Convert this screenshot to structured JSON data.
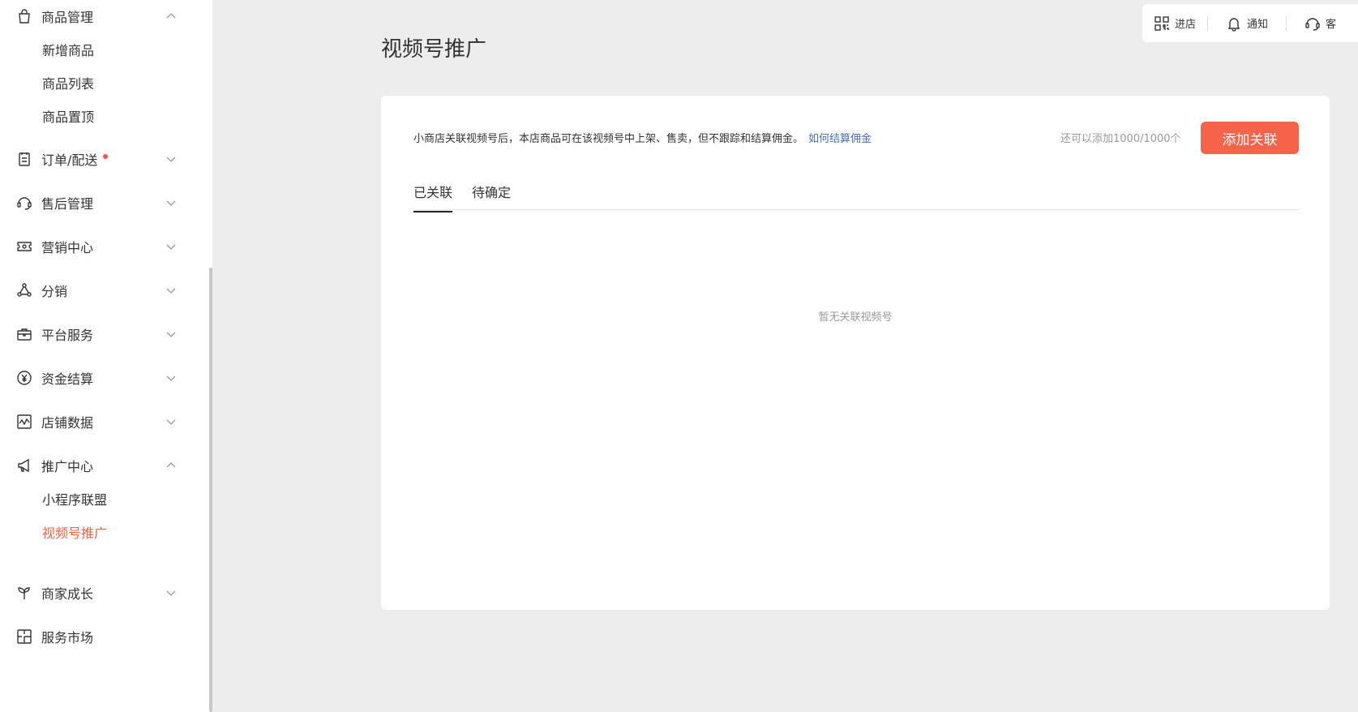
{
  "sidebar": {
    "groups": [
      {
        "label": "商品管理",
        "icon": "bag-icon",
        "expanded": true,
        "items": [
          "新增商品",
          "商品列表",
          "商品置顶"
        ]
      },
      {
        "label": "订单/配送",
        "icon": "clipboard-icon",
        "expanded": false,
        "badge_dot": true
      },
      {
        "label": "售后管理",
        "icon": "headset-icon",
        "expanded": false
      },
      {
        "label": "营销中心",
        "icon": "ticket-icon",
        "expanded": false
      },
      {
        "label": "分销",
        "icon": "share-nodes-icon",
        "expanded": false
      },
      {
        "label": "平台服务",
        "icon": "briefcase-icon",
        "expanded": false
      },
      {
        "label": "资金结算",
        "icon": "yuan-circle-icon",
        "expanded": false
      },
      {
        "label": "店铺数据",
        "icon": "chart-frame-icon",
        "expanded": false
      },
      {
        "label": "推广中心",
        "icon": "megaphone-icon",
        "expanded": true,
        "items": [
          "小程序联盟",
          "视频号推广"
        ],
        "active_item": "视频号推广"
      },
      {
        "label": "商家成长",
        "icon": "sprout-icon",
        "expanded": false
      },
      {
        "label": "服务市场",
        "icon": "puzzle-frame-icon",
        "expanded": false
      }
    ]
  },
  "topbar": {
    "enter_store": "进店",
    "notifications": "通知",
    "service": "客"
  },
  "main": {
    "title": "视频号推广",
    "notice": "小商店关联视频号后，本店商品可在该视频号中上架、售卖，但不跟踪和结算佣金。",
    "notice_link": "如何结算佣金",
    "quota": "还可以添加1000/1000个",
    "add_button": "添加关联",
    "tabs": [
      "已关联",
      "待确定"
    ],
    "active_tab": "已关联",
    "empty_text": "暂无关联视频号"
  },
  "colors": {
    "accent": "#f5634a",
    "active_menu": "#f06446",
    "link": "#4a6ea8",
    "background": "#ededed"
  }
}
